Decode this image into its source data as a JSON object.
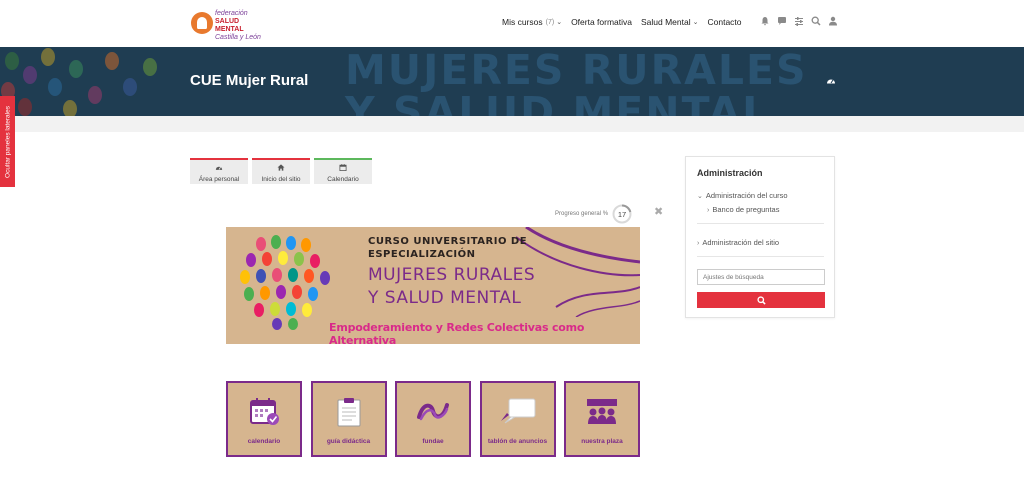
{
  "logo": {
    "line1": "federación",
    "line2": "SALUD MENTAL",
    "line3": "Castilla y León"
  },
  "nav": {
    "items": [
      {
        "label": "Mis cursos",
        "count": "(7)",
        "has_caret": true
      },
      {
        "label": "Oferta formativa",
        "count": "",
        "has_caret": false
      },
      {
        "label": "Salud Mental",
        "count": "",
        "has_caret": true
      },
      {
        "label": "Contacto",
        "count": "",
        "has_caret": false
      }
    ],
    "icons": [
      "bell-icon",
      "chat-icon",
      "sliders-icon",
      "search-icon",
      "user-icon"
    ]
  },
  "banner": {
    "background_text_line1": "MUJERES RURALES",
    "background_text_line2": "Y SALUD MENTAL",
    "page_title": "CUE Mujer Rural"
  },
  "side_tab": {
    "label": "Ocultar paneles laterales"
  },
  "quick_links": [
    {
      "label": "Área personal",
      "icon": "dashboard-icon"
    },
    {
      "label": "Inicio del sitio",
      "icon": "home-icon"
    },
    {
      "label": "Calendario",
      "icon": "calendar-icon"
    }
  ],
  "progress": {
    "label": "Progreso general %",
    "value": "17"
  },
  "course_image": {
    "line1": "CURSO UNIVERSITARIO DE",
    "line2": "ESPECIALIZACIÓN",
    "title1": "MUJERES RURALES",
    "title2": "Y SALUD MENTAL",
    "subtitle": "Empoderamiento y Redes Colectivas como Alternativa"
  },
  "tiles": [
    {
      "label": "calendario",
      "icon": "calendar-check-icon"
    },
    {
      "label": "guía didáctica",
      "icon": "clipboard-icon"
    },
    {
      "label": "fundae",
      "icon": "fundae-logo-icon"
    },
    {
      "label": "tablón de anuncios",
      "icon": "speech-bubble-icon"
    },
    {
      "label": "nuestra plaza",
      "icon": "people-icon"
    }
  ],
  "admin": {
    "title": "Administración",
    "course_admin": "Administración del curso",
    "question_bank": "Banco de preguntas",
    "site_admin": "Administración del sitio",
    "search_placeholder": "Ajustes de búsqueda"
  },
  "colors": {
    "accent_red": "#e4323e",
    "banner_navy": "#1f3d52",
    "purple": "#7b2a8a",
    "kraft": "#d6b58f"
  }
}
